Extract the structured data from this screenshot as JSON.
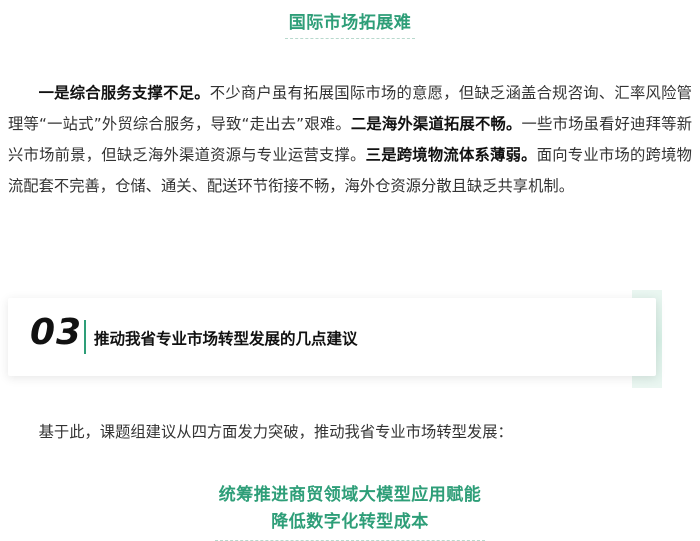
{
  "heading_top": "国际市场拓展难",
  "paragraph": {
    "s1_bold": "一是综合服务支撑不足。",
    "s1_text": "不少商户虽有拓展国际市场的意愿，但缺乏涵盖合规咨询、汇率风险管理等“一站式”外贸综合服务，导致“走出去”艰难。",
    "s2_bold": "二是海外渠道拓展不畅。",
    "s2_text": "一些市场虽看好迪拜等新兴市场前景，但缺乏海外渠道资源与专业运营支撑。",
    "s3_bold": "三是跨境物流体系薄弱。",
    "s3_text": "面向专业市场的跨境物流配套不完善，仓储、通关、配送环节衔接不畅，海外仓资源分散且缺乏共享机制。"
  },
  "section": {
    "number": "03",
    "title": "推动我省专业市场转型发展的几点建议"
  },
  "intro": "基于此，课题组建议从四方面发力突破，推动我省专业市场转型发展：",
  "heading_bottom": {
    "line1": "统筹推进商贸领域大模型应用赋能",
    "line2": "降低数字化转型成本"
  },
  "colors": {
    "accent": "#2e9e78",
    "text": "#333333"
  }
}
